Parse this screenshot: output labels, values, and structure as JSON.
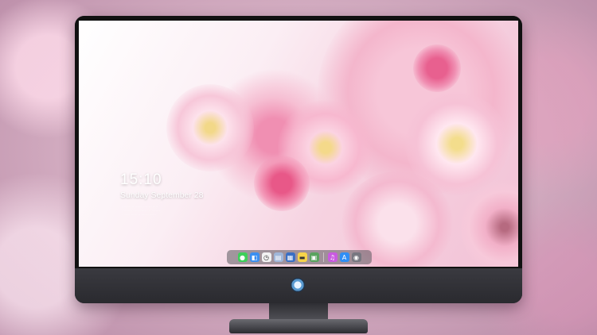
{
  "lock_screen": {
    "time": "15:10",
    "date": "Sunday September 28",
    "info_lines": [
      "· ······· ·· ······· ········ ·· ··",
      "· ········ ····· ········ ·· ·· ·····",
      "· ······ ······ ·· ······· ······"
    ]
  },
  "dock": {
    "icons": [
      {
        "name": "messages-icon",
        "glyph": "●",
        "color": "#3ecf5a"
      },
      {
        "name": "finder-icon",
        "glyph": "◧",
        "color": "#3b8ff0"
      },
      {
        "name": "clock-icon",
        "glyph": "◷",
        "color": "#f2f2f2"
      },
      {
        "name": "preview-icon",
        "glyph": "▤",
        "color": "#9fb6d9"
      },
      {
        "name": "clapper-icon",
        "glyph": "▦",
        "color": "#3a6fc4"
      },
      {
        "name": "notes-icon",
        "glyph": "▬",
        "color": "#f6d34a"
      },
      {
        "name": "photos-icon",
        "glyph": "▣",
        "color": "#5aa35f"
      },
      {
        "name": "music-icon",
        "glyph": "♫",
        "color": "#c95ae0"
      },
      {
        "name": "app-store-icon",
        "glyph": "A",
        "color": "#2f8ef5"
      },
      {
        "name": "camera-icon",
        "glyph": "◉",
        "color": "#777780"
      }
    ]
  }
}
